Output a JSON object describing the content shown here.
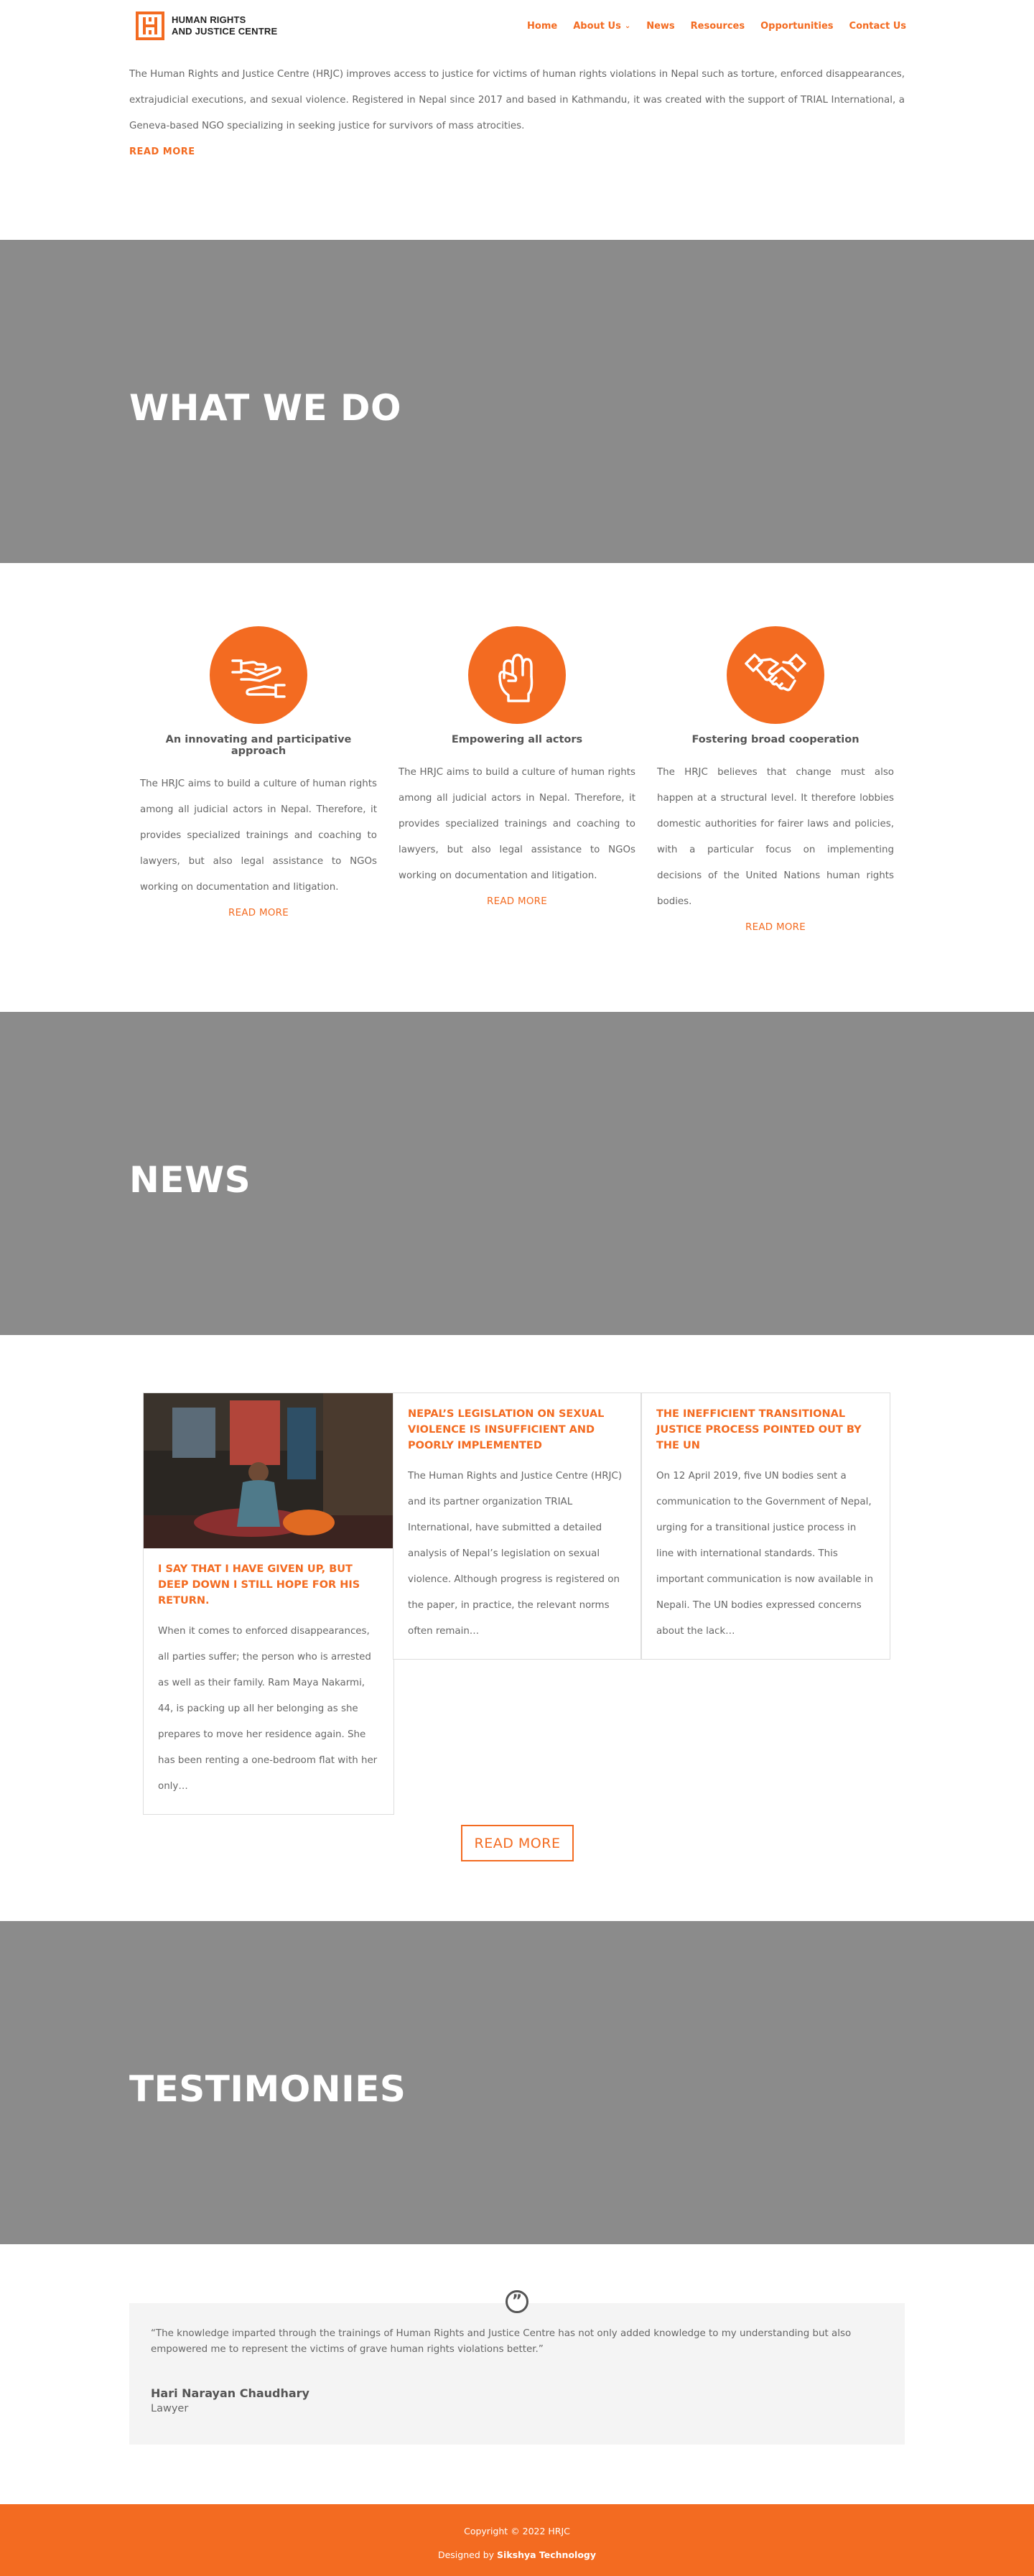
{
  "header": {
    "logo_line1": "HUMAN RIGHTS",
    "logo_line2": "AND JUSTICE CENTRE",
    "nav": [
      {
        "label": "Home"
      },
      {
        "label": "About Us",
        "has_dropdown": true
      },
      {
        "label": "News"
      },
      {
        "label": "Resources"
      },
      {
        "label": "Opportunities"
      },
      {
        "label": "Contact Us"
      }
    ]
  },
  "intro": {
    "text": "The Human Rights and Justice Centre (HRJC) improves access to justice for victims of human rights violations in Nepal such as torture, enforced disappearances, extrajudicial executions, and sexual violence. Registered in Nepal since 2017 and based in Kathmandu, it was created with the support of TRIAL International, a Geneva-based NGO specializing in seeking justice for survivors of mass atrocities.",
    "read_more": "READ MORE"
  },
  "banners": {
    "what_we_do": "WHAT WE DO",
    "news": "NEWS",
    "testimonies": "TESTIMONIES"
  },
  "what_we_do": [
    {
      "icon": "hands-icon",
      "title": "An innovating and participative approach",
      "text": "The HRJC aims to build a culture of human rights among all judicial actors in Nepal. Therefore, it provides specialized trainings and coaching to lawyers, but also legal assistance to NGOs working on documentation and litigation.",
      "link": "READ MORE"
    },
    {
      "icon": "fist-icon",
      "title": "Empowering all actors",
      "text": "The HRJC aims to build a culture of human rights among all judicial actors in Nepal. Therefore, it provides specialized trainings and coaching to lawyers, but also legal assistance to NGOs working on documentation and litigation.",
      "link": "READ MORE"
    },
    {
      "icon": "handshake-icon",
      "title": "Fostering broad cooperation",
      "text": "The HRJC believes that change must also happen at a structural level. It therefore lobbies domestic authorities for fairer laws and policies, with a particular focus on implementing decisions of the United Nations human rights bodies.",
      "link": "READ MORE"
    }
  ],
  "news": {
    "items": [
      {
        "title": "I SAY THAT I HAVE GIVEN UP, BUT DEEP DOWN I STILL HOPE FOR HIS RETURN.",
        "excerpt": "When it comes to enforced disappearances, all parties suffer; the person who is arrested as well as their family. Ram Maya Nakarmi, 44, is packing up all her belonging as she prepares to move her residence again. She has been renting a one-bedroom flat with her only…"
      },
      {
        "title": "NEPAL’S LEGISLATION ON SEXUAL VIOLENCE IS INSUFFICIENT AND POORLY IMPLEMENTED",
        "excerpt": "The Human Rights and Justice Centre (HRJC) and its partner organization TRIAL International, have submitted a detailed analysis of Nepal’s legislation on sexual violence. Although progress is registered on the paper, in practice, the relevant norms often remain…"
      },
      {
        "title": "THE INEFFICIENT TRANSITIONAL JUSTICE PROCESS POINTED OUT BY THE UN",
        "excerpt": "On 12 April 2019, five UN bodies sent a communication to the Government of Nepal, urging for a transitional justice process in line with international standards. This important communication is now available in Nepali. The UN bodies expressed concerns about the lack…"
      }
    ],
    "read_more": "READ MORE"
  },
  "testimony": {
    "quote": "“The knowledge imparted through the trainings of Human Rights and Justice Centre has not only added knowledge to my understanding but also empowered me to represent the victims of grave human rights violations better.”",
    "name": "Hari Narayan Chaudhary",
    "role": "Lawyer"
  },
  "footer": {
    "copyright": "Copyright © 2022 HRJC",
    "designed_prefix": "Designed by ",
    "designed_by": "Sikshya Technology"
  },
  "colors": {
    "accent": "#f36b21",
    "banner_gray": "#8b8b8b"
  }
}
